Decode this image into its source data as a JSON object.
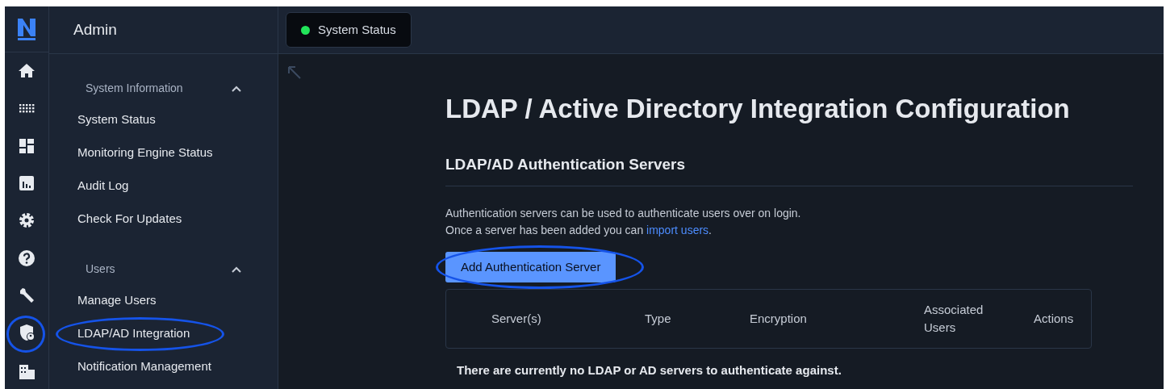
{
  "rail": {
    "icons": [
      {
        "kind": "home",
        "highlighted": false
      },
      {
        "kind": "apps",
        "highlighted": false
      },
      {
        "kind": "dashboard",
        "highlighted": false
      },
      {
        "kind": "chart",
        "highlighted": false
      },
      {
        "kind": "settings",
        "highlighted": false
      },
      {
        "kind": "help",
        "highlighted": false
      },
      {
        "kind": "wrench",
        "highlighted": false
      },
      {
        "kind": "shield-user",
        "highlighted": true
      },
      {
        "kind": "building",
        "highlighted": false
      }
    ]
  },
  "sidebar": {
    "title": "Admin",
    "sections": [
      {
        "label": "System Information",
        "expanded": true,
        "items": [
          {
            "label": "System Status",
            "highlighted": false
          },
          {
            "label": "Monitoring Engine Status",
            "highlighted": false
          },
          {
            "label": "Audit Log",
            "highlighted": false
          },
          {
            "label": "Check For Updates",
            "highlighted": false
          }
        ]
      },
      {
        "label": "Users",
        "expanded": true,
        "items": [
          {
            "label": "Manage Users",
            "highlighted": false
          },
          {
            "label": "LDAP/AD Integration",
            "highlighted": true
          },
          {
            "label": "Notification Management",
            "highlighted": false
          }
        ]
      }
    ]
  },
  "header": {
    "status": {
      "label": "System Status",
      "color": "#22e55a"
    }
  },
  "main": {
    "title": "LDAP / Active Directory Integration Configuration",
    "section_title": "LDAP/AD Authentication Servers",
    "description": [
      "Authentication servers can be used to authenticate users over on login.",
      "Once a server has been added you can "
    ],
    "link": "import users",
    "link_suffix": ".",
    "button": {
      "label": "Add Authentication Server",
      "highlighted": true
    },
    "table": {
      "columns": [
        "Server(s)",
        "Type",
        "Encryption",
        "Associated Users",
        "Actions"
      ]
    },
    "empty_message": "There are currently no LDAP or AD servers to authenticate against."
  }
}
